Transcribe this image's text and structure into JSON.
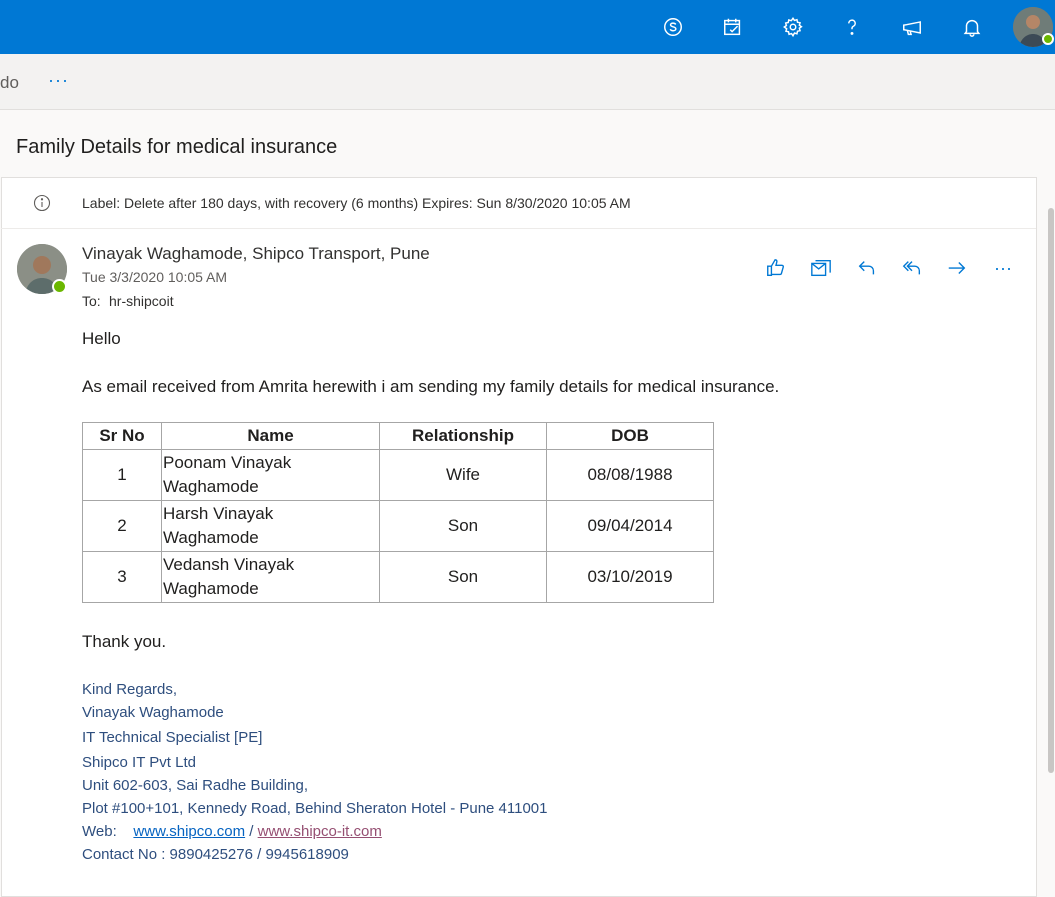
{
  "colors": {
    "brand": "#0078d4",
    "presence": "#6bb700",
    "signature": "#2e4e7e",
    "link": "#0563c1"
  },
  "topbar": {
    "icons": [
      "skype-icon",
      "calendar-check-icon",
      "gear-icon",
      "help-icon",
      "megaphone-icon",
      "bell-icon"
    ]
  },
  "toolbar": {
    "partial_label": "do",
    "more_label": "···"
  },
  "message": {
    "subject": "Family Details for medical insurance",
    "retention_label": "Label: Delete after 180 days, with recovery (6 months) Expires: Sun 8/30/2020 10:05 AM",
    "sender": "Vinayak Waghamode, Shipco Transport, Pune",
    "date": "Tue 3/3/2020 10:05 AM",
    "to_label": "To:",
    "to_value": "hr-shipcoit",
    "more_actions": "···"
  },
  "body": {
    "greeting": "Hello",
    "paragraph": "As email received from Amrita herewith i am sending my family  details for medical insurance.",
    "table": {
      "headers": [
        "Sr No",
        "Name",
        "Relationship",
        "DOB"
      ],
      "rows": [
        {
          "sr": "1",
          "name_line1": "Poonam Vinayak",
          "name_line2": "Waghamode",
          "relationship": "Wife",
          "dob": "08/08/1988"
        },
        {
          "sr": "2",
          "name_line1": "Harsh Vinayak",
          "name_line2": "Waghamode",
          "relationship": "Son",
          "dob": "09/04/2014"
        },
        {
          "sr": "3",
          "name_line1": "Vedansh Vinayak",
          "name_line2": "Waghamode",
          "relationship": "Son",
          "dob": "03/10/2019"
        }
      ]
    },
    "closing": "Thank you."
  },
  "signature": {
    "regards": "Kind Regards,",
    "name": "Vinayak Waghamode",
    "title": "IT Technical Specialist [PE]",
    "company": "Shipco IT Pvt Ltd",
    "address1": "Unit 602-603, Sai Radhe Building,",
    "address2": "Plot #100+101, Kennedy Road, Behind Sheraton Hotel -  Pune 411001",
    "web_label": "Web:",
    "web_link1": "www.shipco.com",
    "web_sep": "/",
    "web_link2": "www.shipco-it.com",
    "contact": "Contact No : 9890425276 / 9945618909"
  }
}
